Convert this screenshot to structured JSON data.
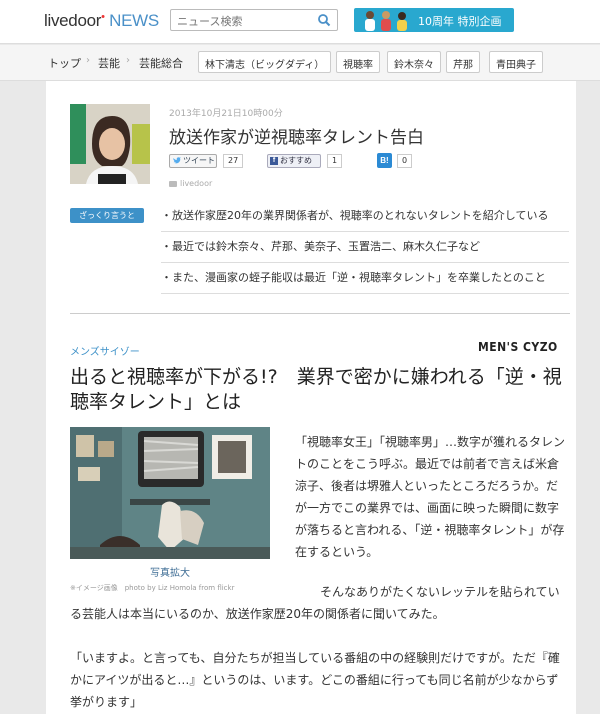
{
  "header": {
    "logo_main": "livedoor",
    "logo_news": "NEWS",
    "search_placeholder": "ニュース検索",
    "banner_text": "10周年 特別企画"
  },
  "breadcrumb": {
    "items": [
      "トップ",
      "芸能",
      "芸能総合"
    ],
    "tags": [
      "林下清志（ビッグダディ）",
      "視聴率",
      "鈴木奈々",
      "芹那",
      "青田典子"
    ]
  },
  "article": {
    "date": "2013年10月21日10時00分",
    "title": "放送作家が逆視聴率タレント告白",
    "tweet_label": "ツイート",
    "tweet_count": "27",
    "fb_label": "おすすめ",
    "fb_count": "1",
    "hb_label": "B!",
    "hb_count": "0",
    "source": "livedoor",
    "summary_badge": "ざっくり言うと",
    "summary": [
      "・放送作家歴20年の業界関係者が、視聴率のとれないタレントを紹介している",
      "・最近では鈴木奈々、芹那、美奈子、玉置浩二、麻木久仁子など",
      "・また、漫画家の蛭子能収は最近「逆・視聴率タレント」を卒業したとのこと"
    ],
    "magazine": "メンズサイゾー",
    "magazine_logo": "MEN'S CYZO",
    "headline": "出ると視聴率が下がる!?　業界で密かに嫌われる「逆・視聴率タレント」とは",
    "photo_caption": "写真拡大",
    "photo_credit": "※イメージ画像　photo by Liz Homola from flickr",
    "para1": "「視聴率女王」「視聴率男」…数字が獲れるタレントのことをこう呼ぶ。最近では前者で言えば米倉涼子、後者は堺雅人といったところだろうか。だが一方でこの業界では、画面に映った瞬間に数字が落ちると言われる、「逆・視聴率タレント」が存在するという。",
    "para2": "そんなありがたくないレッテルを貼られている芸能人は本当にいるのか、放送作家歴20年の関係者に聞いてみた。",
    "para3": "「いますよ。と言っても、自分たちが担当している番組の中の経験則だけですが。ただ『確かにアイツが出ると…』というのは、います。どこの番組に行っても同じ名前が少なからず挙がります」"
  },
  "colors": {
    "accent": "#3d91c8",
    "banner": "#29a8cf",
    "news": "#4a90c8"
  }
}
